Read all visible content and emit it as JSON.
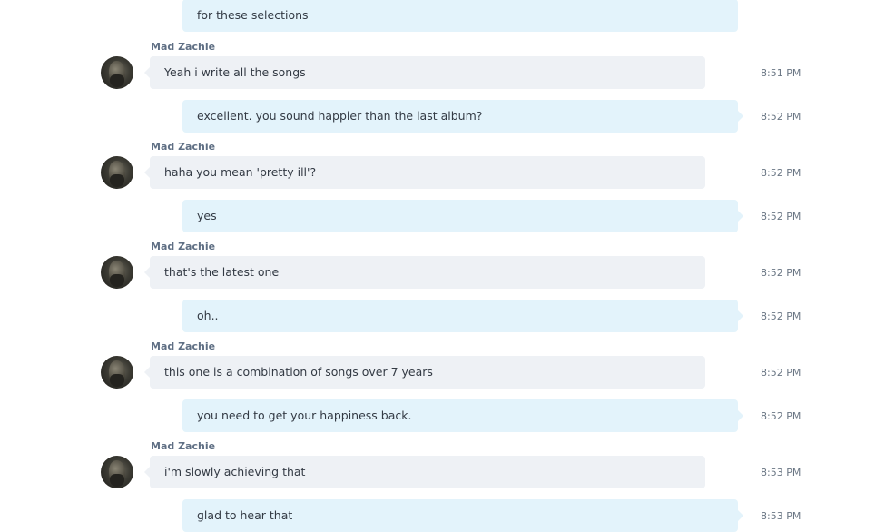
{
  "conversation": {
    "messages": [
      {
        "type": "out",
        "text": "for these selections",
        "time": ""
      },
      {
        "type": "in",
        "sender": "Mad Zachie",
        "text": "Yeah i write all the songs",
        "time": "8:51 PM"
      },
      {
        "type": "out",
        "text": "excellent.  you sound happier than the last album?",
        "time": "8:52 PM"
      },
      {
        "type": "in",
        "sender": "Mad Zachie",
        "text": "haha you mean 'pretty ill'?",
        "time": "8:52 PM"
      },
      {
        "type": "out",
        "text": "yes",
        "time": "8:52 PM"
      },
      {
        "type": "in",
        "sender": "Mad Zachie",
        "text": "that's the latest one",
        "time": "8:52 PM"
      },
      {
        "type": "out",
        "text": "oh..",
        "time": "8:52 PM"
      },
      {
        "type": "in",
        "sender": "Mad Zachie",
        "text": "this one is a combination of songs over 7 years",
        "time": "8:52 PM"
      },
      {
        "type": "out",
        "text": "you need to get your happiness back.",
        "time": "8:52 PM"
      },
      {
        "type": "in",
        "sender": "Mad Zachie",
        "text": "i'm slowly achieving that",
        "time": "8:53 PM"
      },
      {
        "type": "out",
        "text": "glad to hear that",
        "time": "8:53 PM"
      }
    ]
  },
  "colors": {
    "incoming_bubble": "#eef1f5",
    "outgoing_bubble": "#e3f3fb",
    "sender_name": "#5f6f84",
    "timestamp": "#6a7684"
  },
  "icons": {
    "avatar": "contact-avatar-photo"
  }
}
